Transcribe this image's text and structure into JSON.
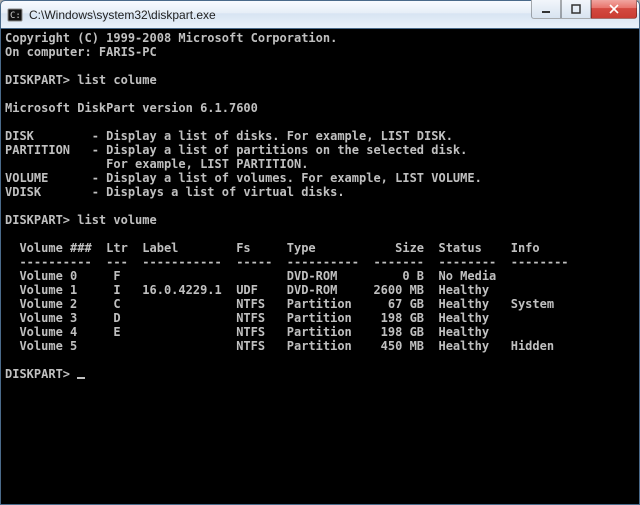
{
  "window": {
    "title": "C:\\Windows\\system32\\diskpart.exe"
  },
  "console": {
    "copyright": "Copyright (C) 1999-2008 Microsoft Corporation.",
    "computer_line": "On computer: FARIS-PC",
    "prompt": "DISKPART>",
    "cmd1": "list colume",
    "version": "Microsoft DiskPart version 6.1.7600",
    "help": [
      {
        "k": "DISK",
        "d": "- Display a list of disks. For example, LIST DISK."
      },
      {
        "k": "PARTITION",
        "d": "- Display a list of partitions on the selected disk."
      },
      {
        "k": "",
        "d": "  For example, LIST PARTITION."
      },
      {
        "k": "VOLUME",
        "d": "- Display a list of volumes. For example, LIST VOLUME."
      },
      {
        "k": "VDISK",
        "d": "- Displays a list of virtual disks."
      }
    ],
    "cmd2": "list volume",
    "table": {
      "headers": [
        "Volume ###",
        "Ltr",
        "Label",
        "Fs",
        "Type",
        "Size",
        "Status",
        "Info"
      ],
      "rows": [
        {
          "vol": "Volume 0",
          "ltr": "F",
          "label": "",
          "fs": "",
          "type": "DVD-ROM",
          "size": "0 B",
          "status": "No Media",
          "info": ""
        },
        {
          "vol": "Volume 1",
          "ltr": "I",
          "label": "16.0.4229.1",
          "fs": "UDF",
          "type": "DVD-ROM",
          "size": "2600 MB",
          "status": "Healthy",
          "info": ""
        },
        {
          "vol": "Volume 2",
          "ltr": "C",
          "label": "",
          "fs": "NTFS",
          "type": "Partition",
          "size": "67 GB",
          "status": "Healthy",
          "info": "System"
        },
        {
          "vol": "Volume 3",
          "ltr": "D",
          "label": "",
          "fs": "NTFS",
          "type": "Partition",
          "size": "198 GB",
          "status": "Healthy",
          "info": ""
        },
        {
          "vol": "Volume 4",
          "ltr": "E",
          "label": "",
          "fs": "NTFS",
          "type": "Partition",
          "size": "198 GB",
          "status": "Healthy",
          "info": ""
        },
        {
          "vol": "Volume 5",
          "ltr": "",
          "label": "",
          "fs": "NTFS",
          "type": "Partition",
          "size": "450 MB",
          "status": "Healthy",
          "info": "Hidden"
        }
      ]
    }
  }
}
